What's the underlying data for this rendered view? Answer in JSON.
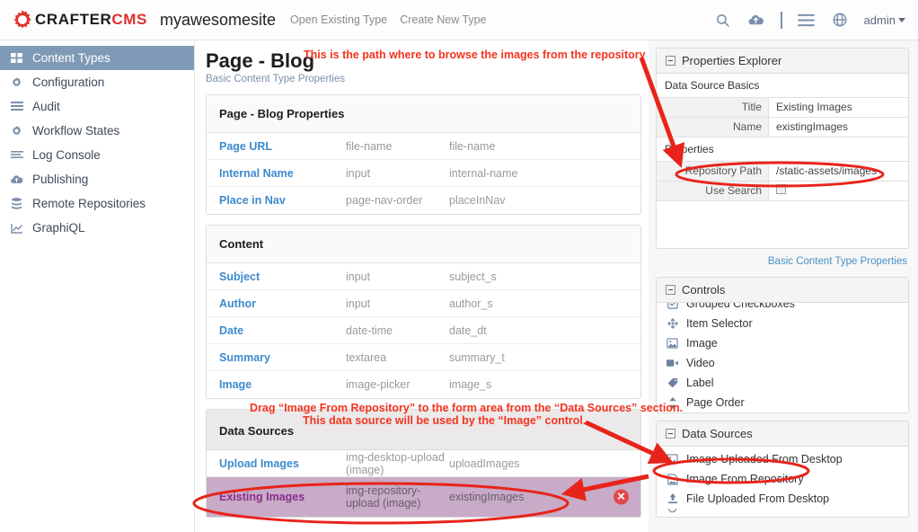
{
  "header": {
    "brand_crafter": "CRAFTER",
    "brand_cms": "CMS",
    "site_name": "myawesomesite",
    "nav": [
      {
        "label": "Open Existing Type"
      },
      {
        "label": "Create New Type"
      }
    ],
    "icons": [
      "search-icon",
      "cloud-upload-icon",
      "hamburger-menu-icon",
      "globe-icon"
    ],
    "user": "admin"
  },
  "sidebar": {
    "items": [
      {
        "label": "Content Types",
        "icon": "grid-icon",
        "active": true
      },
      {
        "label": "Configuration",
        "icon": "gear-icon",
        "active": false
      },
      {
        "label": "Audit",
        "icon": "list-icon",
        "active": false
      },
      {
        "label": "Workflow States",
        "icon": "gear-icon",
        "active": false
      },
      {
        "label": "Log Console",
        "icon": "lines-icon",
        "active": false
      },
      {
        "label": "Publishing",
        "icon": "cloud-icon",
        "active": false
      },
      {
        "label": "Remote Repositories",
        "icon": "database-icon",
        "active": false
      },
      {
        "label": "GraphiQL",
        "icon": "chart-icon",
        "active": false
      }
    ]
  },
  "main": {
    "title": "Page - Blog",
    "subtitle": "Basic Content Type Properties",
    "sections": [
      {
        "heading": "Page - Blog Properties",
        "head_style": "light",
        "rows": [
          {
            "label": "Page URL",
            "control": "file-name",
            "name": "file-name"
          },
          {
            "label": "Internal Name",
            "control": "input",
            "name": "internal-name"
          },
          {
            "label": "Place in Nav",
            "control": "page-nav-order",
            "name": "placeInNav"
          }
        ]
      },
      {
        "heading": "Content",
        "head_style": "light",
        "rows": [
          {
            "label": "Subject",
            "control": "input",
            "name": "subject_s"
          },
          {
            "label": "Author",
            "control": "input",
            "name": "author_s"
          },
          {
            "label": "Date",
            "control": "date-time",
            "name": "date_dt"
          },
          {
            "label": "Summary",
            "control": "textarea",
            "name": "summary_t"
          },
          {
            "label": "Image",
            "control": "image-picker",
            "name": "image_s"
          }
        ]
      },
      {
        "heading": "Data Sources",
        "head_style": "gray",
        "rows": [
          {
            "label": "Upload Images",
            "control": "img-desktop-upload (image)",
            "name": "uploadImages",
            "highlighted": false
          },
          {
            "label": "Existing Images",
            "control": "img-repository-upload (image)",
            "name": "existingImages",
            "highlighted": true,
            "delete_label": "✕"
          }
        ]
      }
    ]
  },
  "properties_explorer": {
    "title": "Properties Explorer",
    "section_basics": "Data Source Basics",
    "basics": [
      {
        "label": "Title",
        "value": "Existing Images"
      },
      {
        "label": "Name",
        "value": "existingImages"
      }
    ],
    "section_properties": "Properties",
    "properties": [
      {
        "label": "Repository Path",
        "value": "/static-assets/images"
      },
      {
        "label": "Use Search",
        "value": "",
        "checkbox": true
      }
    ],
    "footer_link": "Basic Content Type Properties"
  },
  "controls_panel": {
    "title": "Controls",
    "clipped_top_item": {
      "label": "Grouped Checkboxes",
      "icon": "checkbox-group-icon"
    },
    "items": [
      {
        "label": "Item Selector",
        "icon": "move-icon"
      },
      {
        "label": "Image",
        "icon": "image-icon"
      },
      {
        "label": "Video",
        "icon": "video-icon"
      },
      {
        "label": "Label",
        "icon": "tag-icon"
      },
      {
        "label": "Page Order",
        "icon": "updown-arrows-icon"
      }
    ]
  },
  "datasources_panel": {
    "title": "Data Sources",
    "items": [
      {
        "label": "Image Uploaded From Desktop",
        "icon": "image-icon",
        "circled": false
      },
      {
        "label": "Image From Repository",
        "icon": "image-file-icon",
        "circled": true
      },
      {
        "label": "File Uploaded From Desktop",
        "icon": "upload-icon",
        "circled": false
      }
    ]
  },
  "annotations": {
    "path_note": "This is the path where to browse the images from the repository",
    "drag_note_line1": "Drag “Image From Repository” to the form area from the “Data Sources” section.",
    "drag_note_line2": "This data source will be used by the “Image” control.",
    "color": "#f4341f"
  }
}
